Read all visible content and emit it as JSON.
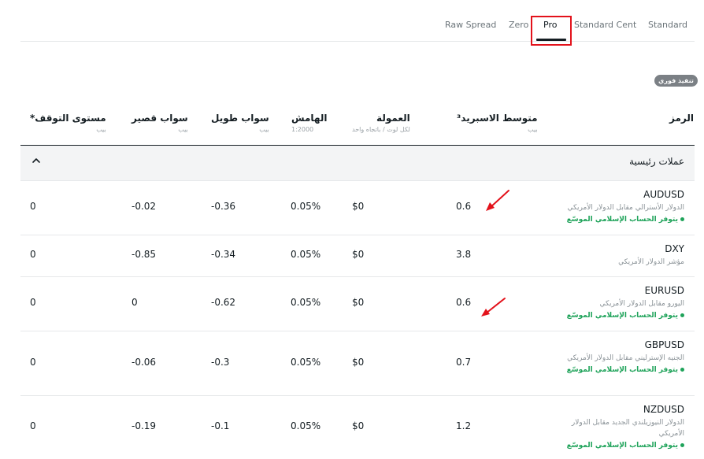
{
  "tabs": [
    {
      "label": "Raw Spread"
    },
    {
      "label": "Zero"
    },
    {
      "label": "Pro",
      "active": true
    },
    {
      "label": "Standard Cent"
    },
    {
      "label": "Standard"
    }
  ],
  "badge": "تنفيذ فوري",
  "columns": {
    "symbol": {
      "title": "الرمز"
    },
    "spread": {
      "title": "متوسط الاسبريد³",
      "sub": "بيب"
    },
    "commission": {
      "title": "العمولة",
      "sub": "لكل لوت / باتجاه واحد"
    },
    "margin": {
      "title": "الهامش",
      "sub": "1:2000"
    },
    "swap_long": {
      "title": "سواب طويل",
      "sub": "بيب"
    },
    "swap_short": {
      "title": "سواب قصير",
      "sub": "بيب"
    },
    "stop_level": {
      "title": "مستوى التوقف*",
      "sub": "بيب"
    }
  },
  "group": {
    "label": "عملات رئيسية"
  },
  "rows": [
    {
      "symbol": "AUDUSD",
      "desc": "الدولار الأسترالي مقابل الدولار الأمريكي",
      "islamic": "يتوفر الحساب الإسلامي الموسّع",
      "spread": "0.6",
      "commission": "$0",
      "margin": "0.05%",
      "swap_long": "-0.36",
      "swap_short": "-0.02",
      "stop_level": "0"
    },
    {
      "symbol": "DXY",
      "desc": "مؤشر الدولار الأمريكي",
      "islamic": "",
      "spread": "3.8",
      "commission": "$0",
      "margin": "0.05%",
      "swap_long": "-0.34",
      "swap_short": "-0.85",
      "stop_level": "0"
    },
    {
      "symbol": "EURUSD",
      "desc": "اليورو مقابل الدولار الأمريكي",
      "islamic": "يتوفر الحساب الإسلامي الموسّع",
      "spread": "0.6",
      "commission": "$0",
      "margin": "0.05%",
      "swap_long": "-0.62",
      "swap_short": "0",
      "stop_level": "0"
    },
    {
      "symbol": "GBPUSD",
      "desc": "الجنيه الإسترليني مقابل الدولار الأمريكي",
      "islamic": "يتوفر الحساب الإسلامي الموسّع",
      "spread": "0.7",
      "commission": "$0",
      "margin": "0.05%",
      "swap_long": "-0.3",
      "swap_short": "-0.06",
      "stop_level": "0"
    },
    {
      "symbol": "NZDUSD",
      "desc": "الدولار النيوزيلندي الجديد مقابل الدولار الأمريكي",
      "islamic": "يتوفر الحساب الإسلامي الموسّع",
      "spread": "1.2",
      "commission": "$0",
      "margin": "0.05%",
      "swap_long": "-0.1",
      "swap_short": "-0.19",
      "stop_level": "0"
    }
  ],
  "colors": {
    "accent": "#141d22",
    "islamic_green": "#1fa35a",
    "annotation_red": "#e3121b"
  }
}
